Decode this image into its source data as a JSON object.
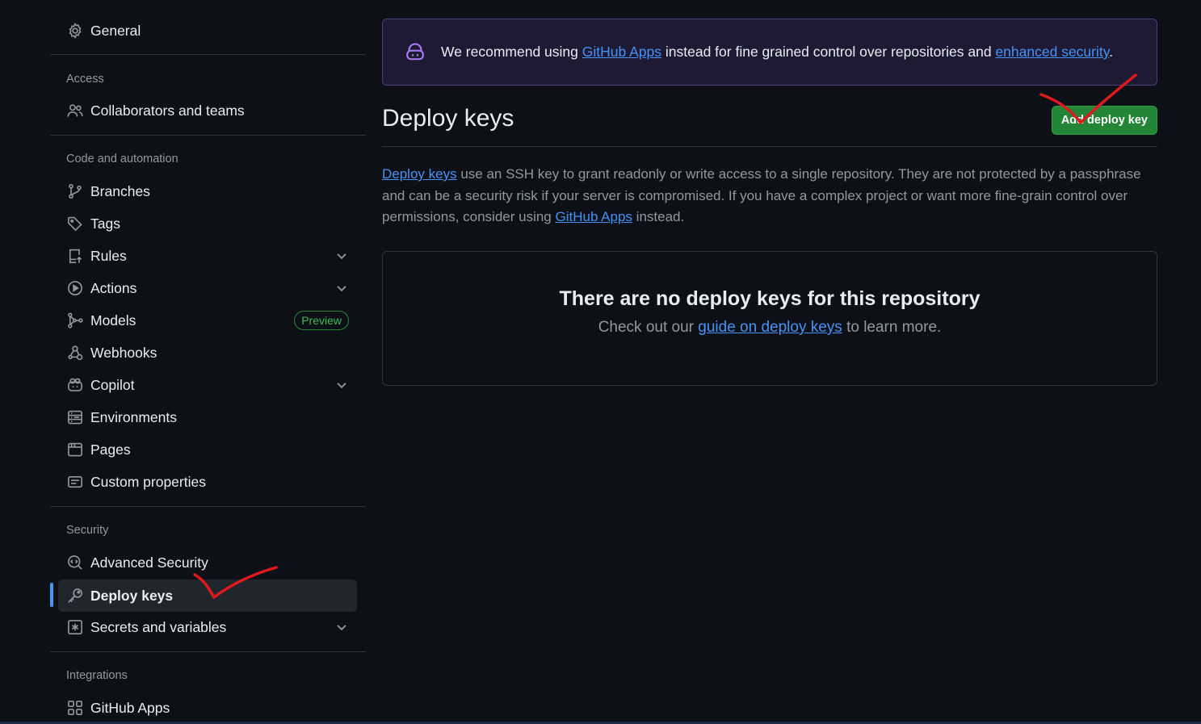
{
  "sidebar": {
    "general": "General",
    "sections": {
      "access": "Access",
      "code": "Code and automation",
      "security": "Security",
      "integrations": "Integrations"
    },
    "items": {
      "collaborators": "Collaborators and teams",
      "branches": "Branches",
      "tags": "Tags",
      "rules": "Rules",
      "actions": "Actions",
      "models": "Models",
      "models_badge": "Preview",
      "webhooks": "Webhooks",
      "copilot": "Copilot",
      "environments": "Environments",
      "pages": "Pages",
      "custom_properties": "Custom properties",
      "advanced_security": "Advanced Security",
      "deploy_keys": "Deploy keys",
      "secrets": "Secrets and variables",
      "github_apps": "GitHub Apps"
    }
  },
  "flash": {
    "pre": "We recommend using ",
    "link1": "GitHub Apps",
    "mid": " instead for fine grained control over repositories and ",
    "link2": "enhanced security",
    "post": "."
  },
  "main": {
    "title": "Deploy keys",
    "add_button": "Add deploy key",
    "desc_link1": "Deploy keys",
    "desc_text1": " use an SSH key to grant readonly or write access to a single repository. They are not protected by a passphrase and can be a security risk if your server is compromised. If you have a complex project or want more fine-grain control over permissions, consider using ",
    "desc_link2": "GitHub Apps",
    "desc_text2": " instead.",
    "blank_title": "There are no deploy keys for this repository",
    "blank_pre": "Check out our ",
    "blank_link": "guide on deploy keys",
    "blank_post": " to learn more."
  },
  "colors": {
    "background": "#0d1117",
    "accent_link": "#4493f8",
    "button_green": "#238636",
    "annotation_red": "#e0191f"
  }
}
